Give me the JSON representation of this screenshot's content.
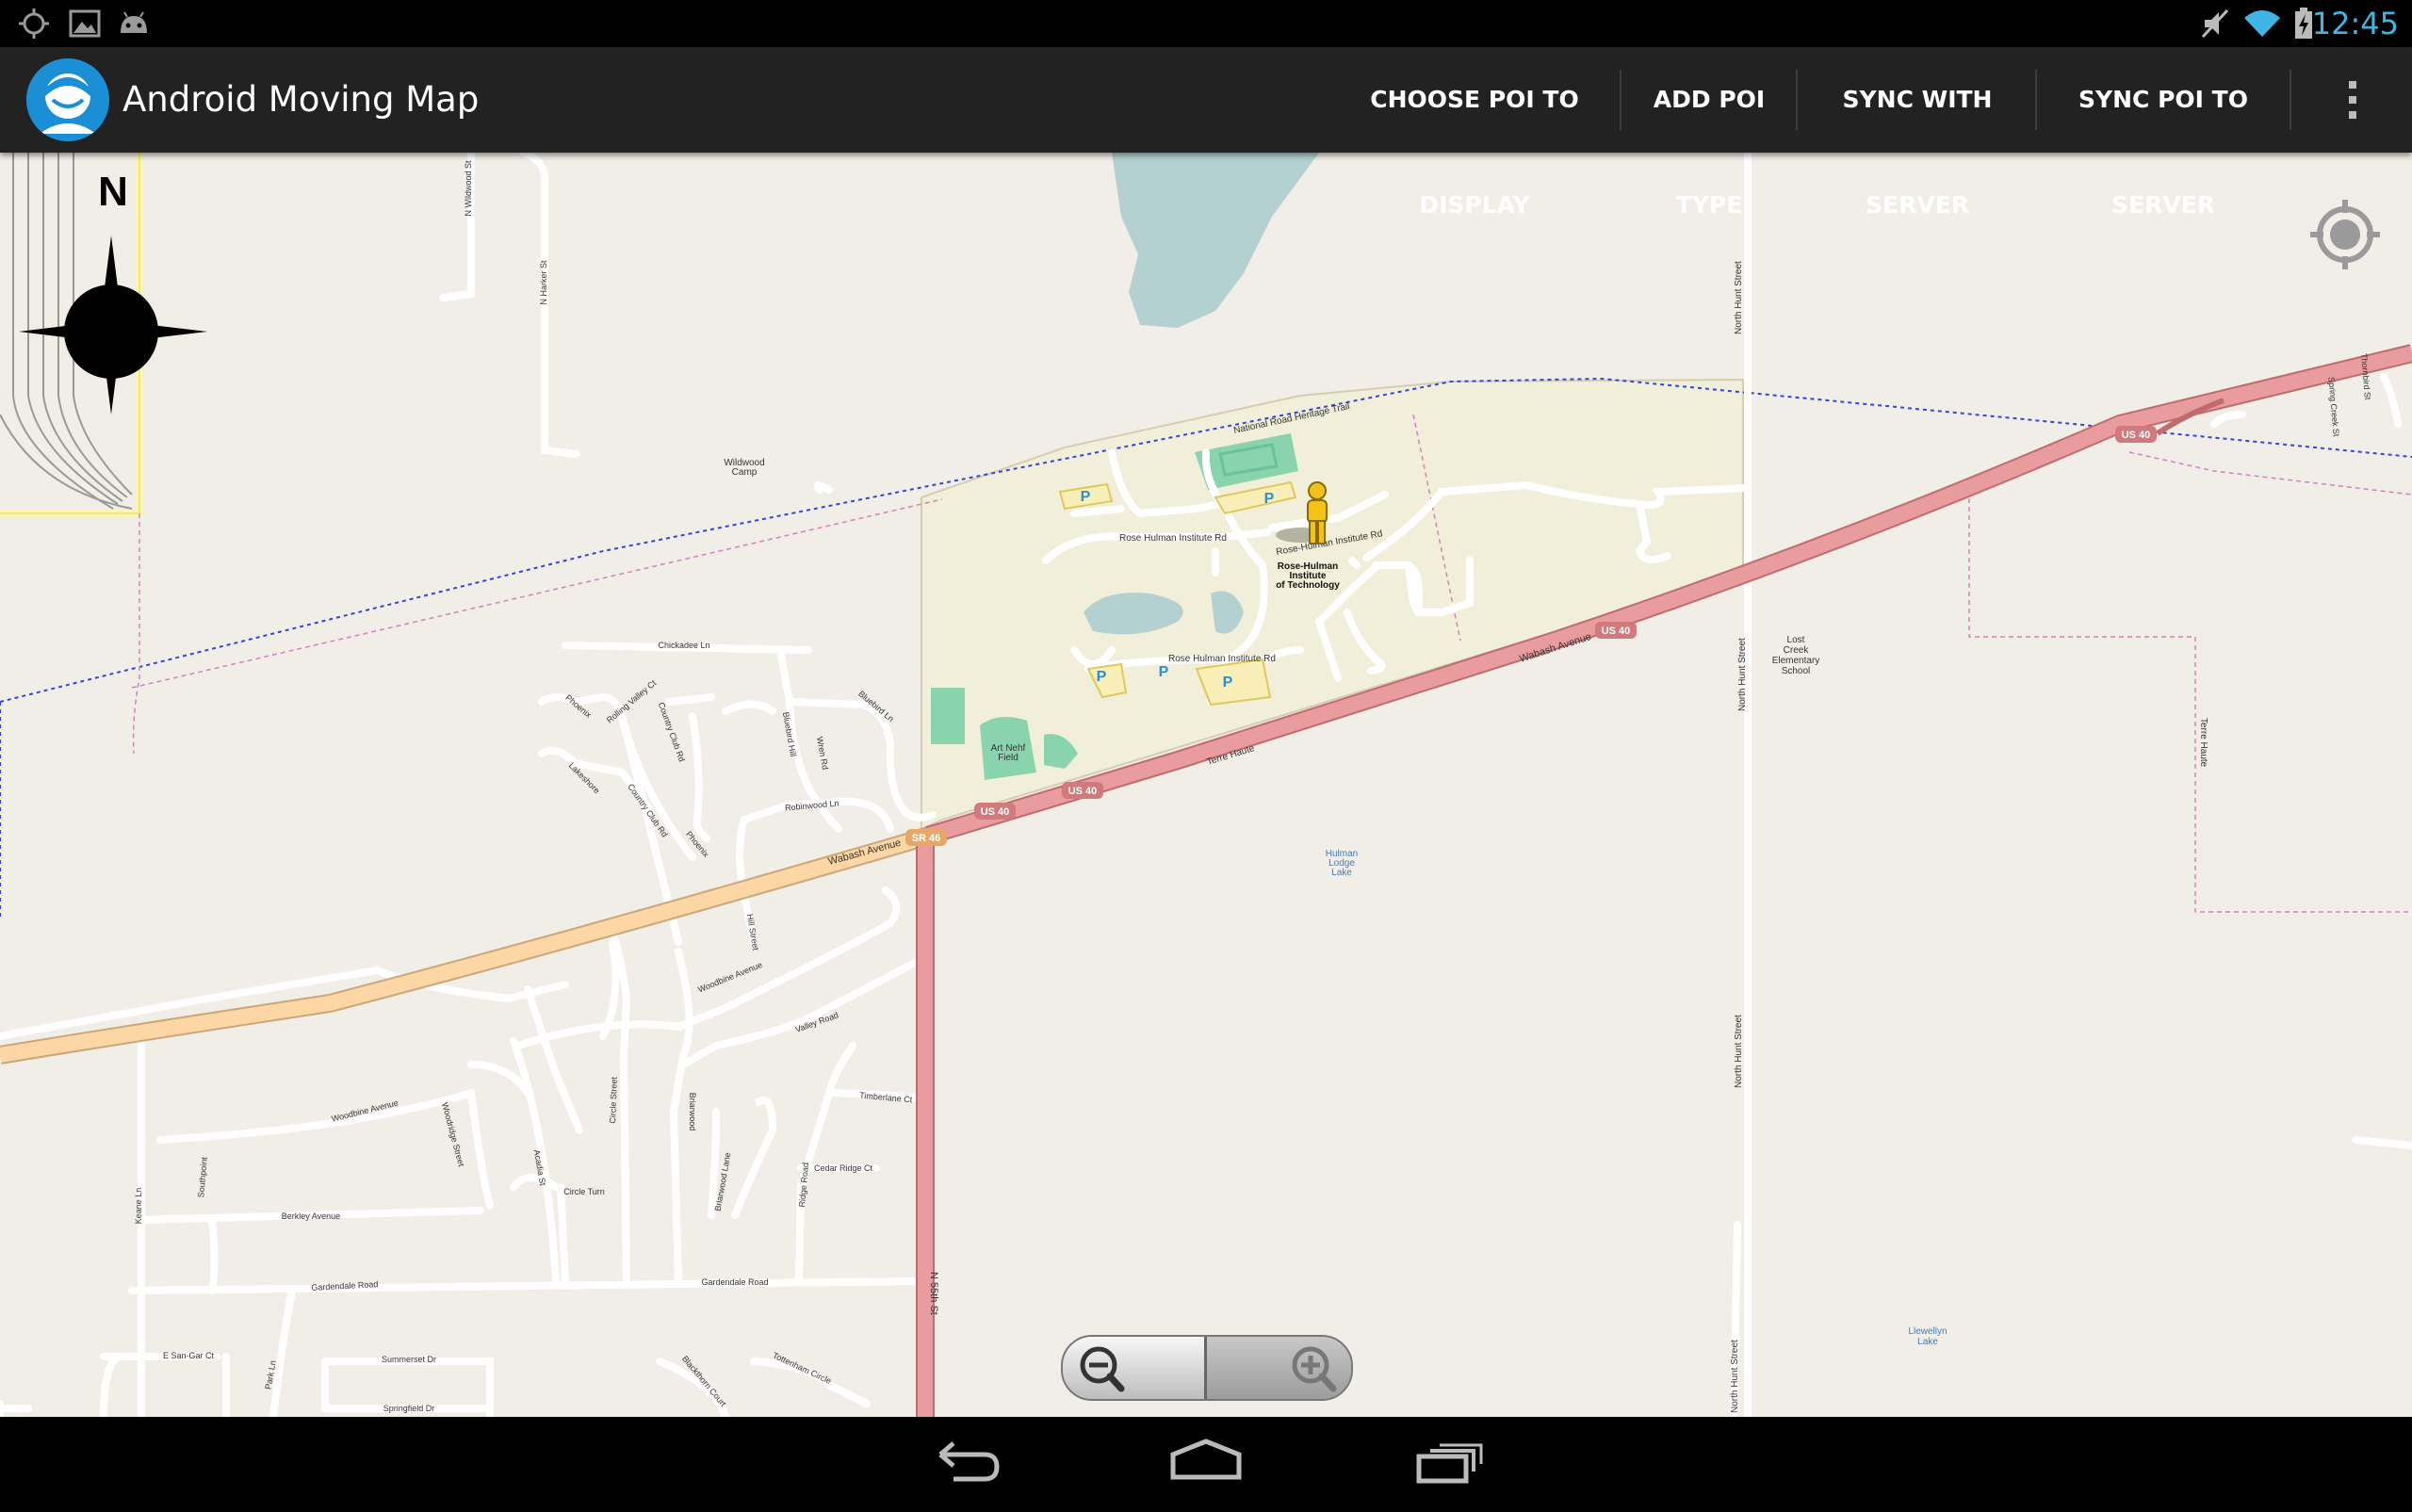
{
  "status_bar": {
    "time": "12:45",
    "icons": [
      "gps-icon",
      "picture-icon",
      "android-icon",
      "mute-icon",
      "wifi-icon",
      "battery-charging-icon"
    ]
  },
  "app": {
    "title": "Android Moving Map",
    "icon": "app-avatar-icon"
  },
  "menu": {
    "choose_poi": "CHOOSE POI TO DISPLAY",
    "add_poi_type": "ADD POI TYPE",
    "sync_with_server": "SYNC WITH SERVER",
    "sync_poi_to_server": "SYNC POI TO SERVER",
    "overflow_icon": "overflow-menu-icon"
  },
  "map": {
    "compass_letter": "N",
    "labels": {
      "national_road": "National Road Heritage Trail",
      "rose_hulman_rd_1": "Rose Hulman Institute Rd",
      "rose_hulman_rd_2": "Rose-Hulman Institute Rd",
      "rose_hulman_rd_3": "Rose Hulman Institute Rd",
      "institute_line1": "Rose-Hulman",
      "institute_line2": "Institute",
      "institute_line3": "of Technology",
      "art_nehf_1": "Art Nehf",
      "art_nehf_2": "Field",
      "wabash_ave_1": "Wabash Avenue",
      "wabash_ave_2": "Wabash Avenue",
      "terre_haute_1": "Terre Haute",
      "terre_haute_2": "Terre Haute",
      "us40_1": "US 40",
      "us40_2": "US 40",
      "us40_3": "US 40",
      "us40_4": "US 40",
      "sr46": "SR 46",
      "n_55th": "N 55th St",
      "north_hunt_1": "North Hunt Street",
      "north_hunt_2": "North Hunt Street",
      "north_hunt_3": "North Hunt Street",
      "north_hunt_4": "North Hunt Street",
      "lost_creek_1": "Lost",
      "lost_creek_2": "Creek",
      "lost_creek_3": "Elementary",
      "lost_creek_4": "School",
      "hulman_lodge_1": "Hulman",
      "hulman_lodge_2": "Lodge",
      "hulman_lodge_3": "Lake",
      "llewellyn_1": "Llewellyn",
      "llewellyn_2": "Lake",
      "wildwood_1": "Wildwood",
      "wildwood_2": "Camp",
      "n_wildwood": "N Wildwood St",
      "n_harker": "N Harker St",
      "chickadee": "Chickadee Ln",
      "bluebird": "Bluebird Ln",
      "bluebird_hill": "Bluebird Hill",
      "wren_rd": "Wren Rd",
      "robinwood": "Robinwood Ln",
      "phoenix_1": "Phoenix",
      "phoenix_2": "Phoenix",
      "rolling_valley": "Rolling Valley Ct",
      "country_club_1": "Country Club Rd",
      "country_club_2": "Country Club Rd",
      "lakeshore": "Lakeshore",
      "hill_street": "Hill Street",
      "woodbine_1": "Woodbine Avenue",
      "woodbine_2": "Woodbine Avenue",
      "valley_road": "Valley Road",
      "timberlane": "Timberlane Ct",
      "cedar_ridge": "Cedar Ridge Ct",
      "ridge_road": "Ridge Road",
      "briarwood": "Briarwood",
      "briarwood_lane": "Briarwood Lane",
      "circle_street": "Circle Street",
      "circle_turn": "Circle Turn",
      "acadia": "Acadia St",
      "woodridge": "Woodridge Street",
      "berkley": "Berkley Avenue",
      "southpoint": "Southpoint",
      "gardendale_1": "Gardendale Road",
      "gardendale_2": "Gardendale Road",
      "keane": "Keane Ln",
      "e_san_gar": "E San-Gar Ct",
      "park_ln": "Park Ln",
      "summerset": "Summerset Dr",
      "springfield": "Springfield Dr",
      "blackthorn": "Blackthorn Court",
      "tottenham": "Tottenham Circle",
      "spring_creek": "Spring Creek St",
      "thornbird": "Thornbird St",
      "parking": "P"
    },
    "icons": [
      "compass-icon",
      "my-location-icon",
      "pegman-icon"
    ]
  },
  "zoom": {
    "zoom_out_icon": "zoom-out-icon",
    "zoom_in_icon": "zoom-in-icon"
  },
  "nav_bar": {
    "icons": [
      "back-icon",
      "home-icon",
      "recent-apps-icon"
    ]
  },
  "colors": {
    "status_time": "#3fb5e6",
    "action_bar": "#222222",
    "map_bg": "#f1eee8",
    "campus": "#f1efd9",
    "trunk_road": "#e99c9e",
    "primary_road": "#fcd6a4",
    "water": "#b5d0d0",
    "field": "#8ad3af"
  }
}
